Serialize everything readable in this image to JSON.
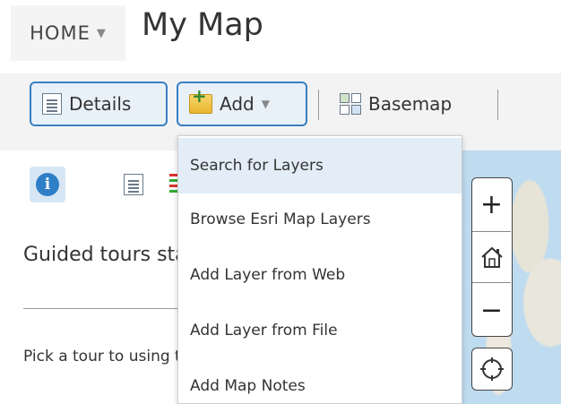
{
  "header": {
    "home_label": "HOME",
    "title": "My Map"
  },
  "toolbar": {
    "details_label": "Details",
    "add_label": "Add",
    "basemap_label": "Basemap"
  },
  "panel": {
    "heading": "Guided tours started",
    "text": "Pick a tour to using the map"
  },
  "map": {
    "zoom_in": "+",
    "zoom_out": "−"
  },
  "add_menu": {
    "items": [
      "Search for Layers",
      "Browse Esri Map Layers",
      "Add Layer from Web",
      "Add Layer from File",
      "Add Map Notes"
    ]
  },
  "colors": {
    "accent": "#3a7fc1",
    "menu_highlight": "#e2edf7",
    "info_blue": "#2f7fc6"
  }
}
